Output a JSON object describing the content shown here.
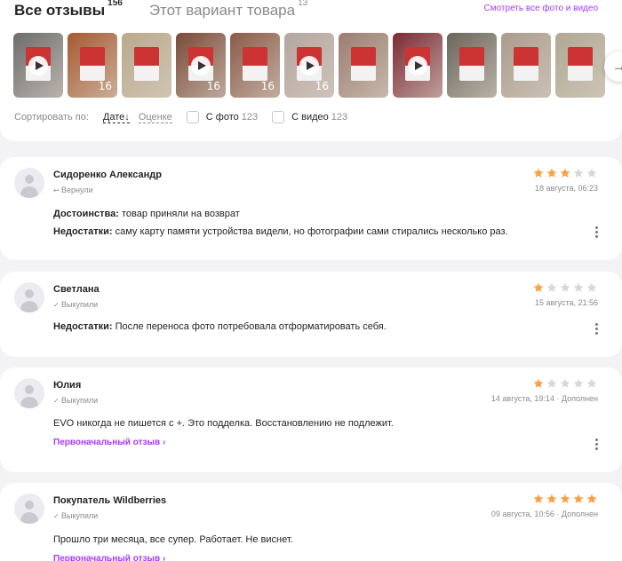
{
  "header": {
    "tab_all": "Все отзывы",
    "tab_all_count": "156",
    "tab_variant": "Этот вариант товара",
    "tab_variant_count": "13",
    "see_all": "Смотреть все фото и видео"
  },
  "gallery": {
    "thumbs": [
      {
        "type": "video",
        "bg": "#6d6d6d",
        "text": ""
      },
      {
        "type": "photo",
        "bg": "#a65a30",
        "text": "16"
      },
      {
        "type": "photo",
        "bg": "#b9aa8c",
        "text": ""
      },
      {
        "type": "video",
        "bg": "#7a4a38",
        "text": "16"
      },
      {
        "type": "photo",
        "bg": "#8a5a48",
        "text": "16"
      },
      {
        "type": "video",
        "bg": "#b4a6a0",
        "text": "16"
      },
      {
        "type": "photo",
        "bg": "#9a7e70",
        "text": ""
      },
      {
        "type": "video",
        "bg": "#7c2a34",
        "text": ""
      },
      {
        "type": "photo",
        "bg": "#6a665c",
        "text": ""
      },
      {
        "type": "photo",
        "bg": "#a99c8c",
        "text": ""
      },
      {
        "type": "photo",
        "bg": "#b0a894",
        "text": ""
      }
    ],
    "next_icon": "→"
  },
  "sort": {
    "label": "Сортировать по:",
    "by_date": "Дате",
    "by_date_arrow": "↓",
    "by_rating": "Оценке",
    "with_photo": "С фото",
    "with_photo_count": "123",
    "with_video": "С видео",
    "with_video_count": "123"
  },
  "reviews": [
    {
      "name": "Сидоренко Александр",
      "status_icon": "↩",
      "status": "Вернули",
      "rating": 3,
      "date": "18 августа, 06:23",
      "pros_label": "Достоинства:",
      "pros": " товар приняли на возврат",
      "cons_label": "Недостатки:",
      "cons": " саму карту памяти устройства видели, но фотографии сами стирались несколько раз."
    },
    {
      "name": "Светлана",
      "status_icon": "✓",
      "status": "Выкупили",
      "rating": 1,
      "date": "15 августа, 21:56",
      "cons_label": "Недостатки:",
      "cons": " После переноса фото потребовала отформатировать себя."
    },
    {
      "name": "Юлия",
      "status_icon": "✓",
      "status": "Выкупили",
      "rating": 1,
      "date": "14 августа, 19:14 · Дополнен",
      "text": "EVO никогда не пишется с +. Это подделка. Восстановлению не подлежит.",
      "orig_link": "Первоначальный отзыв ›"
    },
    {
      "name": "Покупатель Wildberries",
      "status_icon": "✓",
      "status": "Выкупили",
      "rating": 5,
      "date": "09 августа, 10:56 · Дополнен",
      "text": "Прошло три месяца, все супер. Работает. Не виснет.",
      "orig_link": "Первоначальный отзыв ›"
    }
  ],
  "colors": {
    "accent": "#a73afd",
    "star_on": "#ff9f3f",
    "star_off": "#d8d8dc"
  }
}
